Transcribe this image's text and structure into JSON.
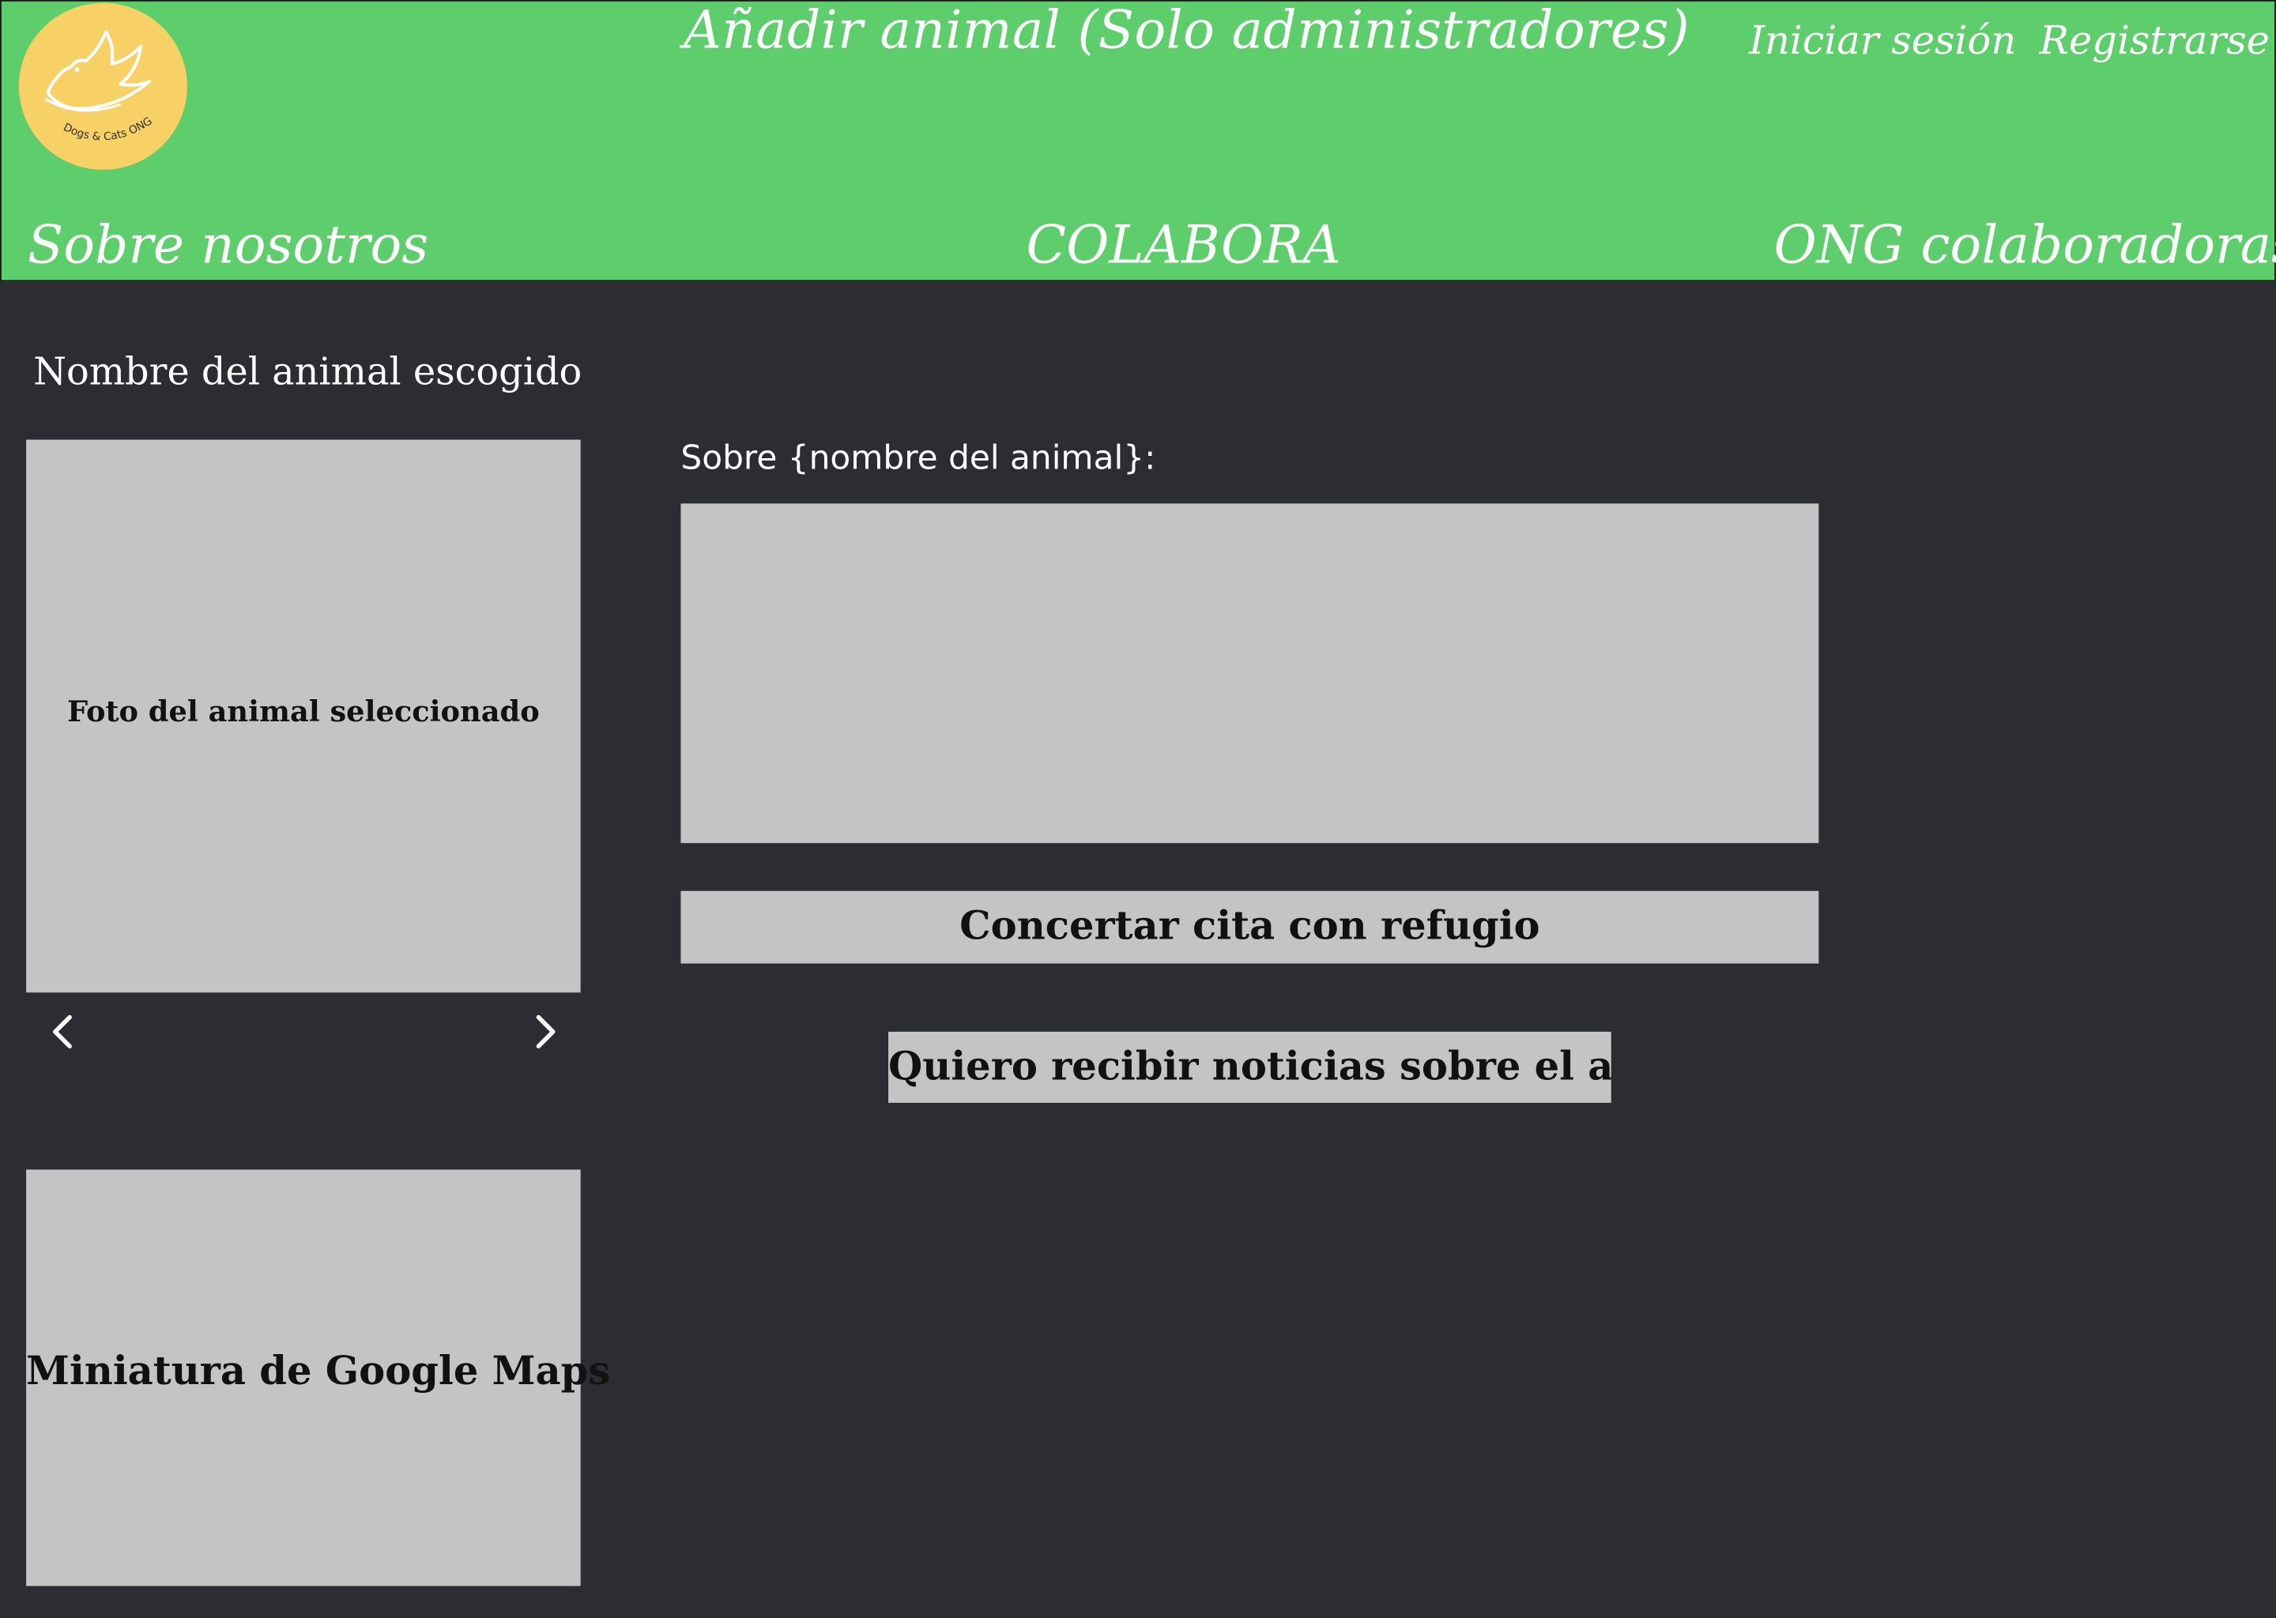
{
  "header": {
    "admin_link": "Añadir animal (Solo administradores)",
    "login": "Iniciar sesión",
    "register": "Registrarse",
    "nav": {
      "about": "Sobre nosotros",
      "colabora": "COLABORA",
      "ong": "ONG colaboradoras"
    },
    "logo_text": "Dogs & Cats ONG",
    "colors": {
      "header_bg": "#5ecd6b",
      "logo_bg": "#f7d066"
    }
  },
  "animal": {
    "title": "Nombre del animal escogido",
    "photo_placeholder": "Foto del animal seleccionado",
    "prev_icon": "chevron-left-icon",
    "next_icon": "chevron-right-icon"
  },
  "map": {
    "placeholder": "Miniatura de Google Maps"
  },
  "about": {
    "label": "Sobre {nombre del animal}:"
  },
  "actions": {
    "appointment": "Concertar cita con refugio",
    "news": "Quiero recibir noticias sobre el animal"
  },
  "colors": {
    "page_bg": "#2c2d32",
    "placeholder_bg": "#c4c4c4"
  }
}
